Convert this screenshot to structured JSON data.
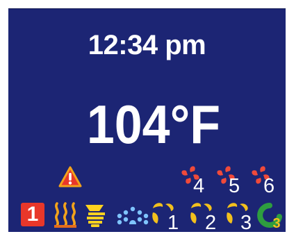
{
  "screen": {
    "time": "12:34 pm",
    "temperature": "104°F"
  },
  "status_badge": {
    "value": "1"
  },
  "icons": {
    "warning": "warning-triangle-icon",
    "heater": "heater-icon",
    "light": "light-icon",
    "jets": "jets-icon",
    "pump": "pump-icon",
    "blower": "blower-icon",
    "ozone": "ozone-icon"
  },
  "blowers": [
    {
      "label": "4"
    },
    {
      "label": "5"
    },
    {
      "label": "6"
    }
  ],
  "pumps": [
    {
      "label": "1"
    },
    {
      "label": "2"
    },
    {
      "label": "3"
    }
  ],
  "ozone": {
    "badge": "3"
  },
  "colors": {
    "background": "#1c2574",
    "text": "#ffffff",
    "warning": "#e8372a",
    "heater": "#f3a31b",
    "light": "#ffd21f",
    "jets": "#7fc4ff",
    "pump": "#f2c01d",
    "blower": "#f04a3a",
    "ozone_ring": "#2e9d3f",
    "ozone_badge": "#f2c01d"
  }
}
